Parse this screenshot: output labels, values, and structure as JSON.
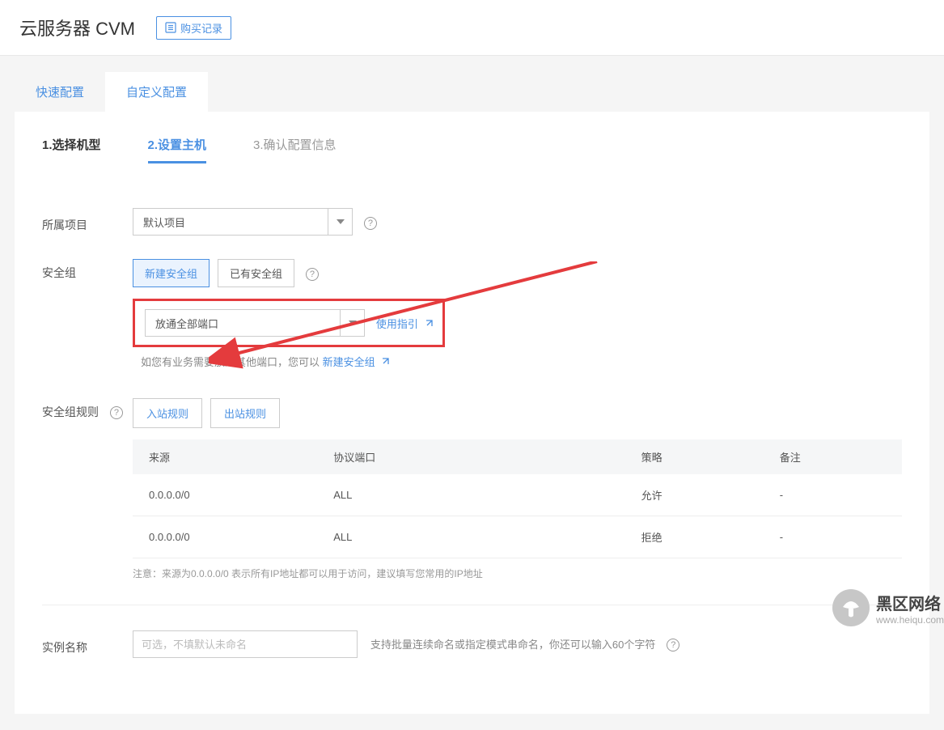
{
  "header": {
    "title": "云服务器 CVM",
    "record_button": "购买记录"
  },
  "top_tabs": {
    "quick": "快速配置",
    "custom": "自定义配置",
    "active": "custom"
  },
  "steps": {
    "s1": "1.选择机型",
    "s2": "2.设置主机",
    "s3": "3.确认配置信息",
    "active": "s2"
  },
  "project": {
    "label": "所属项目",
    "selected": "默认项目"
  },
  "security_group": {
    "label": "安全组",
    "new_btn": "新建安全组",
    "existing_btn": "已有安全组",
    "active": "new",
    "port_selected": "放通全部端口",
    "usage_guide": "使用指引",
    "hint_prefix": "如您有业务需要放通其他端口，您可以 ",
    "hint_link": "新建安全组"
  },
  "security_rules": {
    "label": "安全组规则",
    "tab_in": "入站规则",
    "tab_out": "出站规则",
    "active": "in",
    "headers": {
      "source": "来源",
      "protocol": "协议端口",
      "policy": "策略",
      "remark": "备注"
    },
    "rows": [
      {
        "source": "0.0.0.0/0",
        "protocol": "ALL",
        "policy": "允许",
        "remark": "-"
      },
      {
        "source": "0.0.0.0/0",
        "protocol": "ALL",
        "policy": "拒绝",
        "remark": "-"
      }
    ],
    "note": "注意：来源为0.0.0.0/0 表示所有IP地址都可以用于访问，建议填写您常用的IP地址"
  },
  "instance": {
    "label": "实例名称",
    "placeholder": "可选，不填默认未命名",
    "hint": "支持批量连续命名或指定模式串命名，你还可以输入60个字符"
  },
  "watermark": {
    "brand": "黑区网络",
    "url": "www.heiqu.com"
  }
}
